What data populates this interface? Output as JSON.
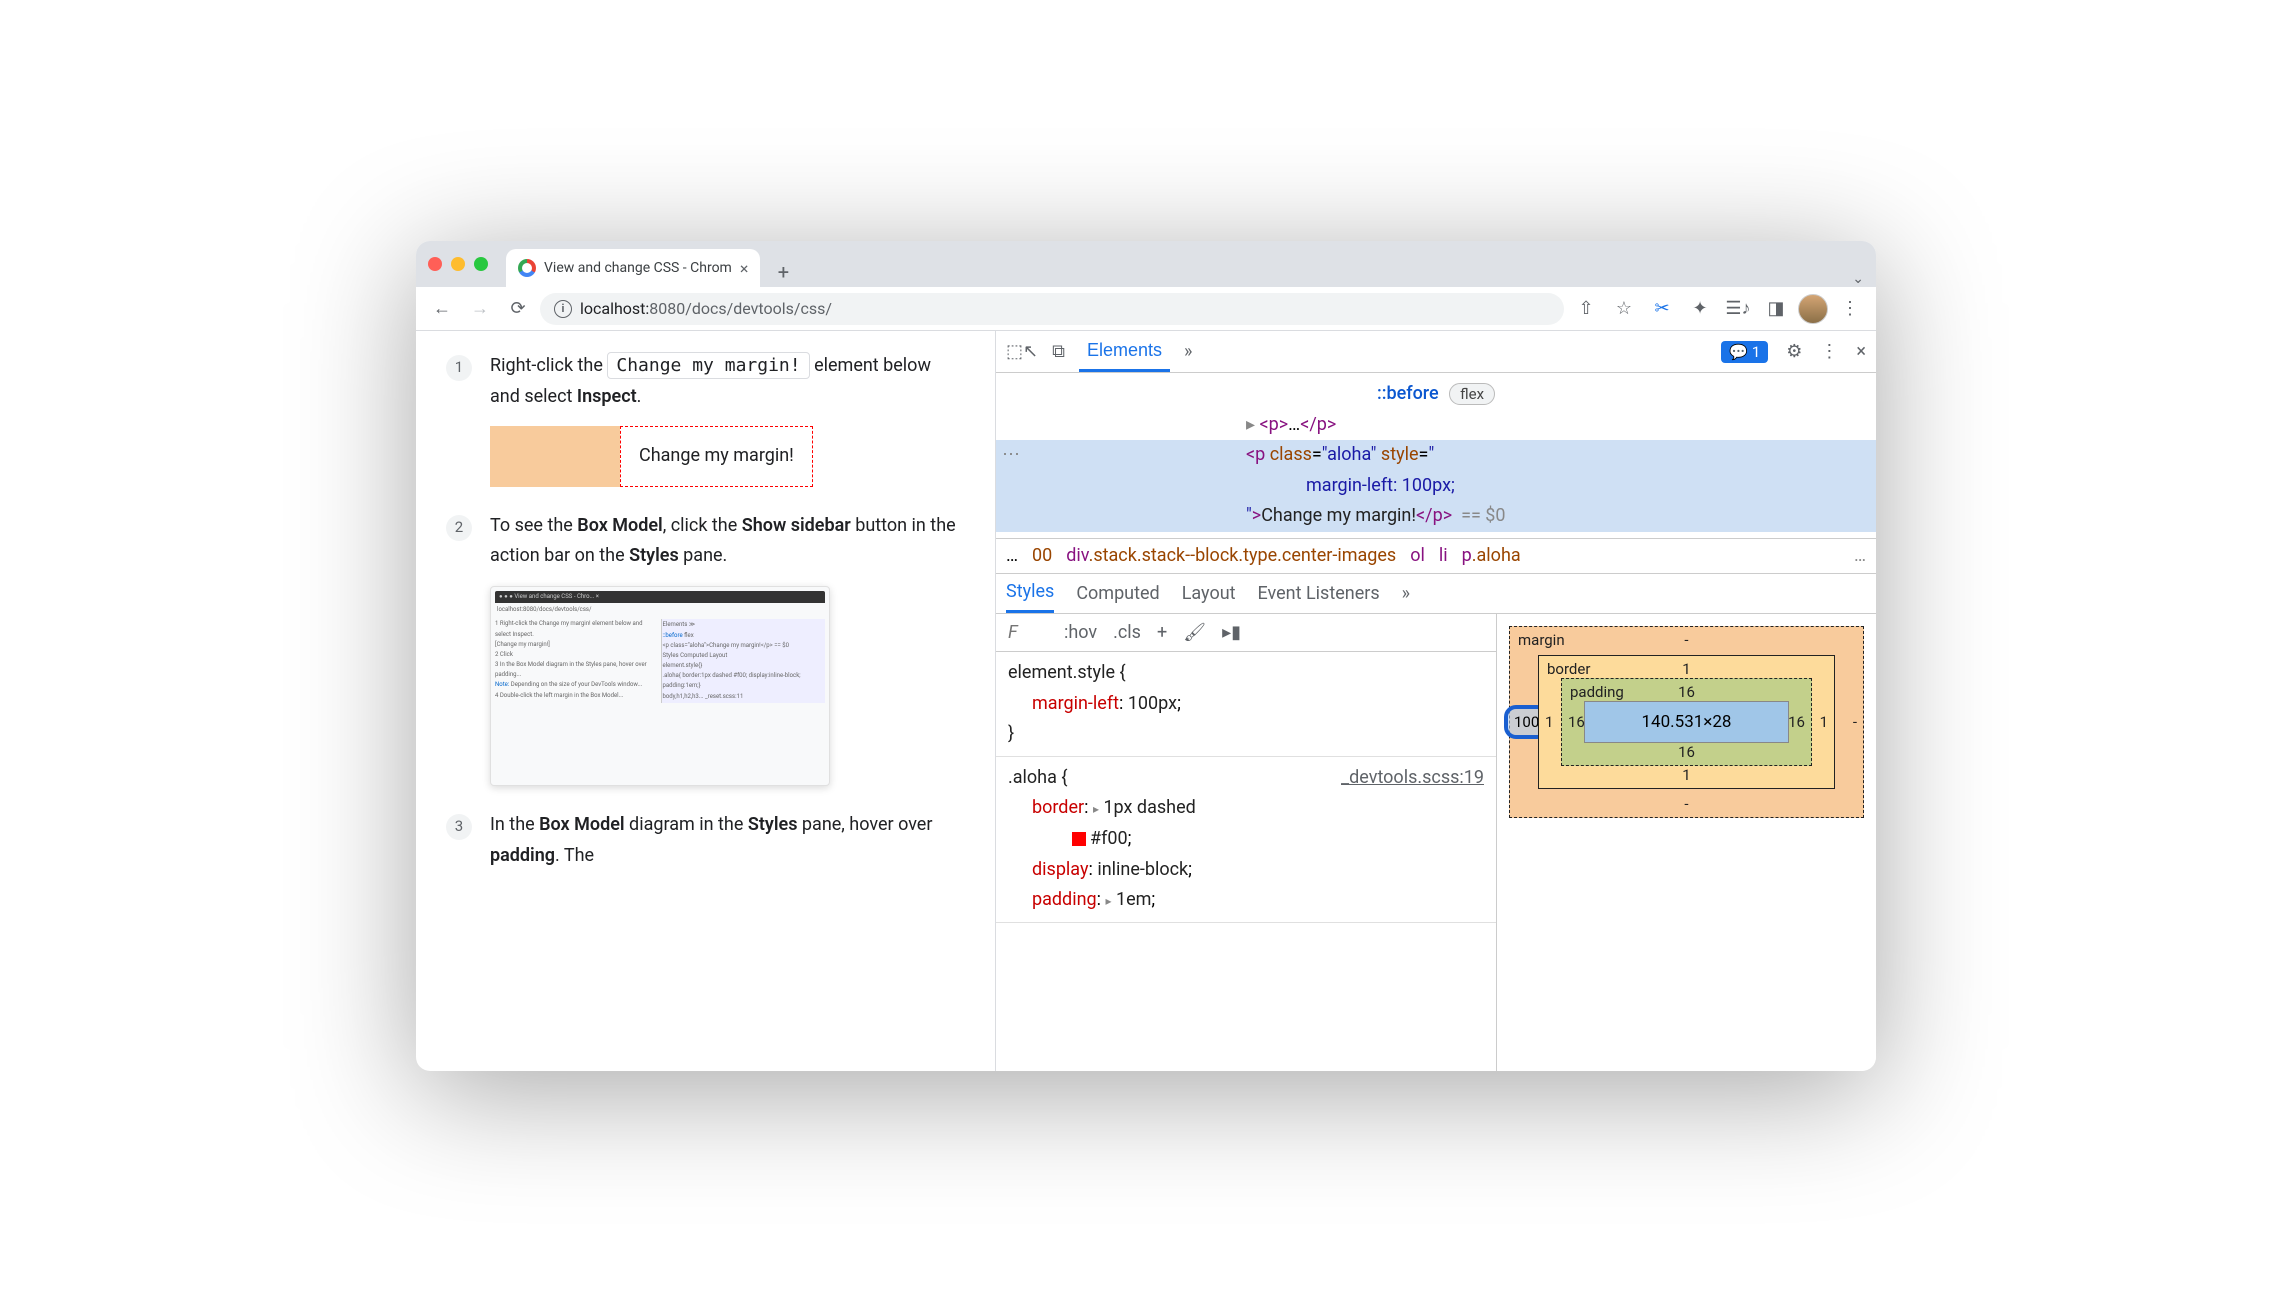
{
  "chrome": {
    "tab_title": "View and change CSS - Chrom",
    "url_host": "localhost:",
    "url_port": "8080",
    "url_path": "/docs/devtools/css/"
  },
  "page": {
    "step1": {
      "num": "1",
      "pre": "Right-click the ",
      "code": "Change my margin!",
      "post": " element below and select ",
      "bold": "Inspect",
      "demo_text": "Change my margin!"
    },
    "step2": {
      "num": "2",
      "t1": "To see the ",
      "b1": "Box Model",
      "t2": ", click the ",
      "b2": "Show sidebar",
      "t3": " button in the action bar on the ",
      "b3": "Styles",
      "t4": " pane."
    },
    "step3": {
      "num": "3",
      "t1": "In the ",
      "b1": "Box Model",
      "t2": " diagram in the ",
      "b2": "Styles",
      "t3": " pane, hover over ",
      "b3": "padding",
      "t4": ". The"
    }
  },
  "devtools": {
    "tabs": {
      "elements": "Elements",
      "issues_count": "1"
    },
    "dom": {
      "before": "::before",
      "flex_badge": "flex",
      "p_collapsed_open": "<p>",
      "p_collapsed_mid": "…",
      "p_collapsed_close": "</p>",
      "sel_open": "<p ",
      "sel_class_attr": "class",
      "sel_class_val": "\"aloha\"",
      "sel_style_attr": "style",
      "sel_style_val_open": "\"",
      "sel_style_rule": "margin-left: 100px;",
      "sel_style_val_close": "\"",
      "sel_text": "Change my margin!",
      "sel_close": "</p>",
      "eq0": "== $0"
    },
    "crumbs": {
      "dots": "…",
      "cut": "00",
      "c1": "div.stack.stack--block.type.center-images",
      "c2": "ol",
      "c3": "li",
      "c4": "p.aloha"
    },
    "subtabs": {
      "styles": "Styles",
      "computed": "Computed",
      "layout": "Layout",
      "listeners": "Event Listeners"
    },
    "styles_toolbar": {
      "filter": "F",
      "hov": ":hov",
      "cls": ".cls"
    },
    "css": {
      "element_style": "element.style {",
      "ml_prop": "margin-left",
      "ml_val": "100px",
      "close": "}",
      "aloha_sel": ".aloha {",
      "aloha_src": "_devtools.scss:19",
      "border_prop": "border",
      "border_val": "1px dashed",
      "border_color": "#f00",
      "display_prop": "display",
      "display_val": "inline-block",
      "padding_prop": "padding",
      "padding_val": "1em"
    },
    "boxmodel": {
      "margin_label": "margin",
      "border_label": "border",
      "padding_label": "padding",
      "content": "140.531×28",
      "m_top": "-",
      "m_right": "-",
      "m_bottom": "-",
      "m_left": "100",
      "b_top": "1",
      "b_right": "1",
      "b_bottom": "1",
      "b_left": "1",
      "p_top": "16",
      "p_right": "16",
      "p_bottom": "16",
      "p_left": "16"
    }
  }
}
